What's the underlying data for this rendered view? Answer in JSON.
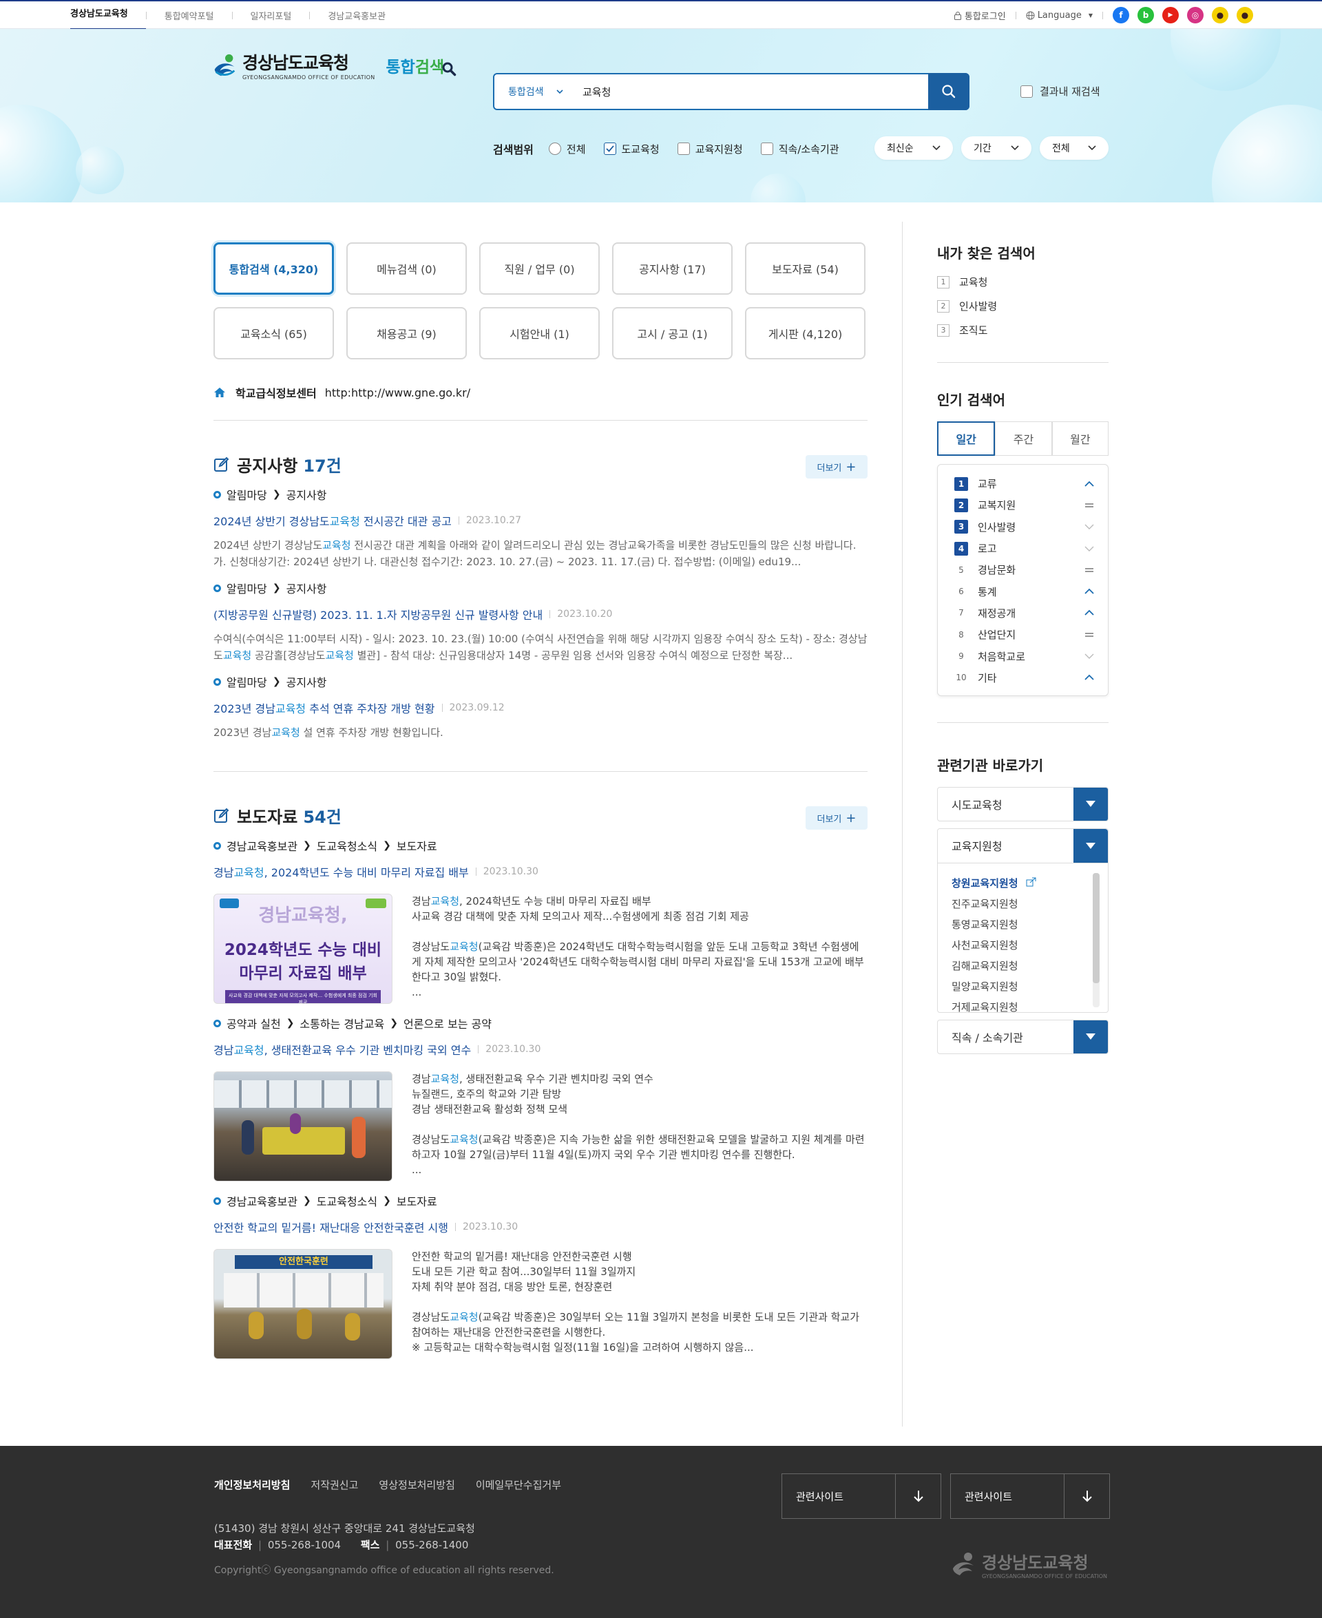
{
  "topbar": {
    "links": [
      "경상남도교육청",
      "통합예약포털",
      "일자리포털",
      "경남교육홍보관"
    ],
    "login": "통합로그인",
    "language": "Language",
    "sns": [
      {
        "name": "facebook-icon",
        "color": "#1877f2",
        "glyph": "f"
      },
      {
        "name": "band-icon",
        "color": "#28c13c",
        "glyph": "b"
      },
      {
        "name": "youtube-icon",
        "color": "#e62117",
        "glyph": "▶"
      },
      {
        "name": "instagram-icon",
        "color": "#d63384",
        "glyph": "◎"
      },
      {
        "name": "kakaotalk-icon",
        "color": "#f5d000",
        "glyph": "●"
      },
      {
        "name": "kakaostory-icon",
        "color": "#f5d000",
        "glyph": "●"
      }
    ]
  },
  "header": {
    "logo_ko": "경상남도교육청",
    "logo_en": "GYEONGSANGNAMDO OFFICE OF EDUCATION",
    "logo_sub_a": "통합",
    "logo_sub_b": "검색",
    "search_category": "통합검색",
    "search_value": "교육청",
    "research_label": "결과내 재검색"
  },
  "scope": {
    "label": "검색범위",
    "options": [
      {
        "label": "전체",
        "type": "radio",
        "checked": false
      },
      {
        "label": "도교육청",
        "type": "checkbox",
        "checked": true
      },
      {
        "label": "교육지원청",
        "type": "checkbox",
        "checked": false
      },
      {
        "label": "직속/소속기관",
        "type": "checkbox",
        "checked": false
      }
    ],
    "sort": "최신순",
    "period": "기간",
    "range": "전체"
  },
  "tabs": [
    {
      "label": "통합검색 (4,320)",
      "active": true
    },
    {
      "label": "메뉴검색 (0)"
    },
    {
      "label": "직원 / 업무 (0)"
    },
    {
      "label": "공지사항 (17)"
    },
    {
      "label": "보도자료 (54)"
    },
    {
      "label": "교육소식 (65)"
    },
    {
      "label": "채용공고 (9)"
    },
    {
      "label": "시험안내 (1)"
    },
    {
      "label": "고시 / 공고 (1)"
    },
    {
      "label": "게시판 (4,120)"
    }
  ],
  "quick": {
    "name": "학교급식정보센터",
    "url": "http:http://www.gne.go.kr/"
  },
  "notice": {
    "title": "공지사항",
    "count": "17건",
    "more": "더보기",
    "items": [
      {
        "crumb": [
          "알림마당",
          "공지사항"
        ],
        "title_a": "2024년 상반기 경상남도",
        "title_hl": "교육청",
        "title_b": " 전시공간 대관 공고",
        "date": "2023.10.27",
        "desc_a": "2024년 상반기 경상남도",
        "desc_hl": "교육청",
        "desc_b": " 전시공간 대관 계획을 아래와 같이 알려드리오니 관심 있는 경남교육가족을 비롯한 경남도민들의 많은 신청 바랍니다. 가. 신청대상기간: 2024년 상반기 나. 대관신청 접수기간: 2023. 10. 27.(금) ~ 2023. 11. 17.(금) 다. 접수방법: (이메일) edu19..."
      },
      {
        "crumb": [
          "알림마당",
          "공지사항"
        ],
        "title": "(지방공무원 신규발령) 2023. 11. 1.자 지방공무원 신규 발령사항 안내",
        "date": "2023.10.20",
        "desc_a": "수여식(수여식은 11:00부터 시작) - 일시: 2023. 10. 23.(월) 10:00 (수여식 사전연습을 위해 해당 시각까지 임용장 수여식 장소 도착) - 장소: 경상남도",
        "desc_hl": "교육청",
        "desc_b": " 공감홀[경상남도",
        "desc_hl2": "교육청",
        "desc_c": " 별관] - 참석 대상: 신규임용대상자 14명 - 공무원 임용 선서와 임용장 수여식 예정으로 단정한 복장..."
      },
      {
        "crumb": [
          "알림마당",
          "공지사항"
        ],
        "title_a": "2023년 경남",
        "title_hl": "교육청",
        "title_b": " 추석 연휴 주차장 개방 현황",
        "date": "2023.09.12",
        "desc_a": "2023년 경남",
        "desc_hl": "교육청",
        "desc_b": " 설 연휴 주차장 개방 현황입니다."
      }
    ]
  },
  "press": {
    "title": "보도자료",
    "count": "54건",
    "more": "더보기",
    "items": [
      {
        "crumb": [
          "경남교육홍보관",
          "도교육청소식",
          "보도자료"
        ],
        "title_a": "경남",
        "title_hl": "교육청",
        "title_b": ", 2024학년도 수능 대비 마무리 자료집 배부",
        "date": "2023.10.30",
        "thumb_a": "경남교육청,",
        "thumb_b": "2024학년도 수능 대비",
        "thumb_c": "마무리 자료집 배부",
        "thumb_d": "사교육 경감 대책에 맞춘 자체 모의고사 제작… 수험생에게 최종 점검 기회 제공",
        "l1a": "경남",
        "l1hl": "교육청",
        "l1b": ", 2024학년도 수능 대비 마무리 자료집 배부",
        "l2": "사교육 경감 대책에 맞춘 자체 모의고사 제작...수험생에게 최종 점검 기회 제공",
        "p_a": "경상남도",
        "p_hl": "교육청",
        "p_b": "(교육감 박종훈)은 2024학년도 대학수학능력시험을 앞둔 도내 고등학교 3학년 수험생에게 자체 제작한 모의고사 '2024학년도 대학수학능력시험 대비 마무리 자료집'을 도내 153개 고교에 배부한다고 30일 밝혔다.",
        "ell": "..."
      },
      {
        "crumb": [
          "공약과 실천",
          "소통하는 경남교육",
          "언론으로 보는 공약"
        ],
        "title_a": "경남",
        "title_hl": "교육청",
        "title_b": ", 생태전환교육 우수 기관 벤치마킹 국외 연수",
        "date": "2023.10.30",
        "l1a": "경남",
        "l1hl": "교육청",
        "l1b": ", 생태전환교육 우수 기관 벤치마킹 국외 연수",
        "l2": "뉴질랜드, 호주의 학교와 기관 탐방",
        "l3": "경남 생태전환교육 활성화 정책 모색",
        "p_a": "경상남도",
        "p_hl": "교육청",
        "p_b": "(교육감 박종훈)은 지속 가능한 삶을 위한 생태전환교육 모델을 발굴하고 지원 체계를 마련하고자 10월 27일(금)부터 11월 4일(토)까지 국외 우수 기관 벤치마킹 연수를 진행한다.",
        "ell": "..."
      },
      {
        "crumb": [
          "경남교육홍보관",
          "도교육청소식",
          "보도자료"
        ],
        "title": "안전한 학교의 밑거름! 재난대응 안전한국훈련 시행",
        "date": "2023.10.30",
        "thumb_banner": "안전한국훈련",
        "l1": "안전한 학교의 밑거름! 재난대응 안전한국훈련 시행",
        "l2": "도내 모든 기관 학교 참여...30일부터 11월 3일까지",
        "l3": "자체 취약 분야 점검, 대응 방안 토론, 현장훈련",
        "p_a": "경상남도",
        "p_hl": "교육청",
        "p_b": "(교육감 박종훈)은 30일부터 오는 11월 3일까지 본청을 비롯한 도내 모든 기관과 학교가 참여하는 재난대응 안전한국훈련을 시행한다.",
        "p2": "※ 고등학교는 대학수학능력시험 일정(11월 16일)을 고려하여 시행하지 않음..."
      }
    ]
  },
  "my_search": {
    "title": "내가 찾은 검색어",
    "items": [
      "교육청",
      "인사발령",
      "조직도"
    ]
  },
  "popular": {
    "title": "인기 검색어",
    "tabs": [
      "일간",
      "주간",
      "월간"
    ],
    "items": [
      {
        "label": "교류",
        "trend": "up"
      },
      {
        "label": "교복지원",
        "trend": "same"
      },
      {
        "label": "인사발령",
        "trend": "down"
      },
      {
        "label": "로고",
        "trend": "down"
      },
      {
        "label": "경남문화",
        "trend": "same"
      },
      {
        "label": "통계",
        "trend": "up"
      },
      {
        "label": "재정공개",
        "trend": "up"
      },
      {
        "label": "산업단지",
        "trend": "same"
      },
      {
        "label": "처음학교로",
        "trend": "down"
      },
      {
        "label": "기타",
        "trend": "up"
      }
    ]
  },
  "related": {
    "title": "관련기관 바로가기",
    "sel1": "시도교육청",
    "sel2": "교육지원청",
    "sel3": "직속 / 소속기관",
    "list": [
      "창원교육지원청",
      "진주교육지원청",
      "통영교육지원청",
      "사천교육지원청",
      "김해교육지원청",
      "밀양교육지원청",
      "거제교육지원청"
    ]
  },
  "footer": {
    "links": [
      "개인정보처리방침",
      "저작권신고",
      "영상정보처리방침",
      "이메일무단수집거부"
    ],
    "address": "(51430) 경남 창원시 성산구 중앙대로 241 경상남도교육청",
    "tel_label": "대표전화",
    "tel": "055-268-1004",
    "fax_label": "팩스",
    "fax": "055-268-1400",
    "copyright": "Copyrightⓒ Gyeongsangnamdo office of education all rights reserved.",
    "site1": "관련사이트",
    "site2": "관련사이트",
    "logo_ko": "경상남도교육청",
    "logo_en": "GYEONGSANGNAMDO OFFICE OF EDUCATION"
  }
}
